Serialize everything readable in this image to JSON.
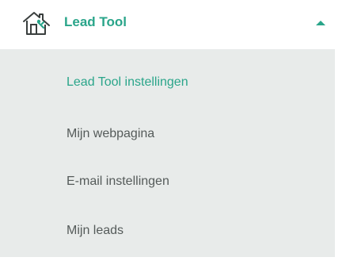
{
  "header": {
    "title": "Lead Tool",
    "icon": "house-icon",
    "toggle_icon": "caret-up-icon",
    "accent_color": "#2aa58a"
  },
  "submenu": {
    "background_color": "#e8ebea",
    "items": [
      {
        "label": "Lead Tool instellingen",
        "active": true
      },
      {
        "label": "Mijn webpagina",
        "active": false
      },
      {
        "label": "E-mail instellingen",
        "active": false
      },
      {
        "label": "Mijn leads",
        "active": false
      }
    ]
  }
}
